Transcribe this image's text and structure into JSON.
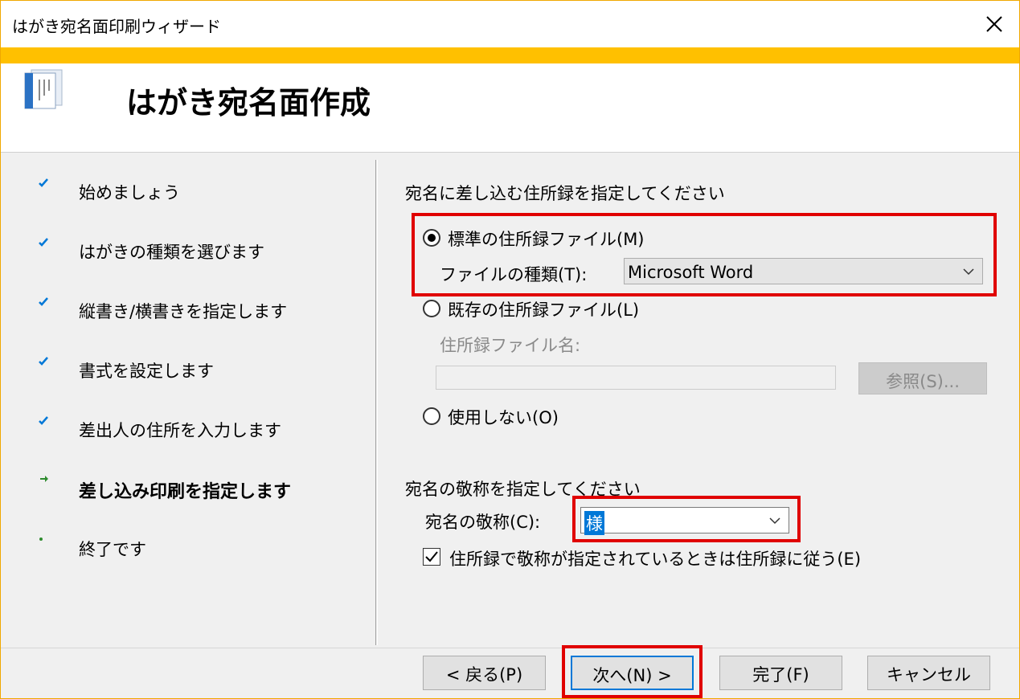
{
  "window": {
    "title": "はがき宛名面印刷ウィザード"
  },
  "header": {
    "title": "はがき宛名面作成"
  },
  "steps": [
    {
      "label": "始めましょう",
      "state": "done"
    },
    {
      "label": "はがきの種類を選びます",
      "state": "done"
    },
    {
      "label": "縦書き/横書きを指定します",
      "state": "done"
    },
    {
      "label": "書式を設定します",
      "state": "done"
    },
    {
      "label": "差出人の住所を入力します",
      "state": "done"
    },
    {
      "label": "差し込み印刷を指定します",
      "state": "current"
    },
    {
      "label": "終了です",
      "state": "pending"
    }
  ],
  "address_source": {
    "heading": "宛名に差し込む住所録を指定してください",
    "standard": {
      "label": "標準の住所録ファイル(M)",
      "selected": true
    },
    "file_type_label": "ファイルの種類(T):",
    "file_type_value": "Microsoft Word",
    "existing": {
      "label": "既存の住所録ファイル(L)",
      "selected": false
    },
    "existing_name_label": "住所録ファイル名:",
    "existing_name_value": "",
    "browse_label": "参照(S)...",
    "none": {
      "label": "使用しない(O)",
      "selected": false
    }
  },
  "honorific": {
    "heading": "宛名の敬称を指定してください",
    "label": "宛名の敬称(C):",
    "value": "様",
    "follow_label": "住所録で敬称が指定されているときは住所録に従う(E)",
    "follow_checked": true
  },
  "footer": {
    "back_label": "< 戻る(P)",
    "next_label": "次へ(N) >",
    "finish_label": "完了(F)",
    "cancel_label": "キャンセル"
  },
  "colors": {
    "accent": "#ffc000",
    "highlight": "#e00000",
    "check": "#0078d7",
    "arrow": "#2e8b2e"
  }
}
